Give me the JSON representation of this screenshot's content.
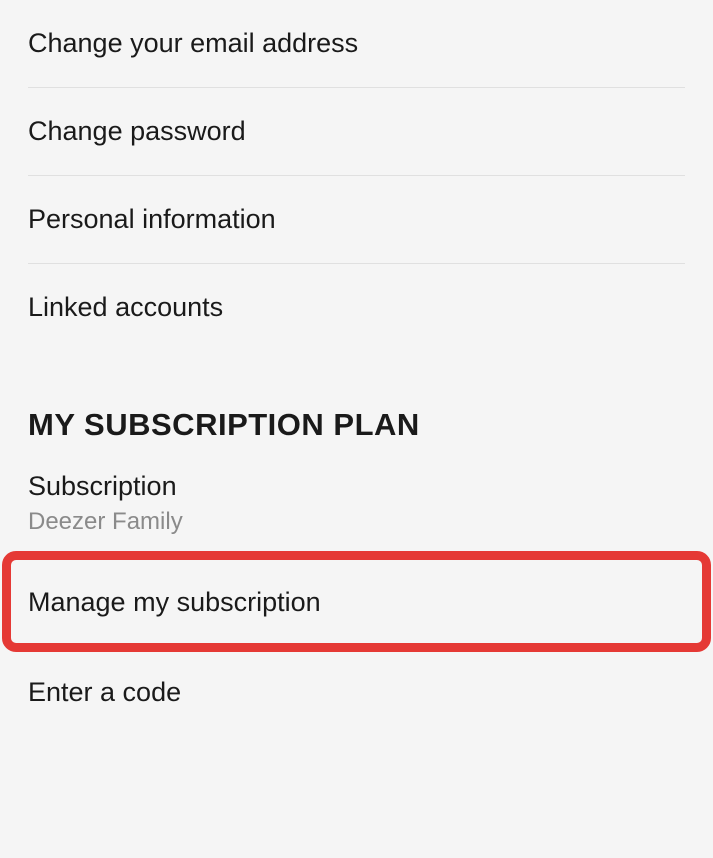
{
  "account_settings": {
    "items": [
      {
        "label": "Change your email address"
      },
      {
        "label": "Change password"
      },
      {
        "label": "Personal information"
      },
      {
        "label": "Linked accounts"
      }
    ]
  },
  "subscription_plan": {
    "header": "MY SUBSCRIPTION PLAN",
    "subscription": {
      "label": "Subscription",
      "value": "Deezer Family"
    },
    "manage_label": "Manage my subscription",
    "enter_code_label": "Enter a code"
  }
}
